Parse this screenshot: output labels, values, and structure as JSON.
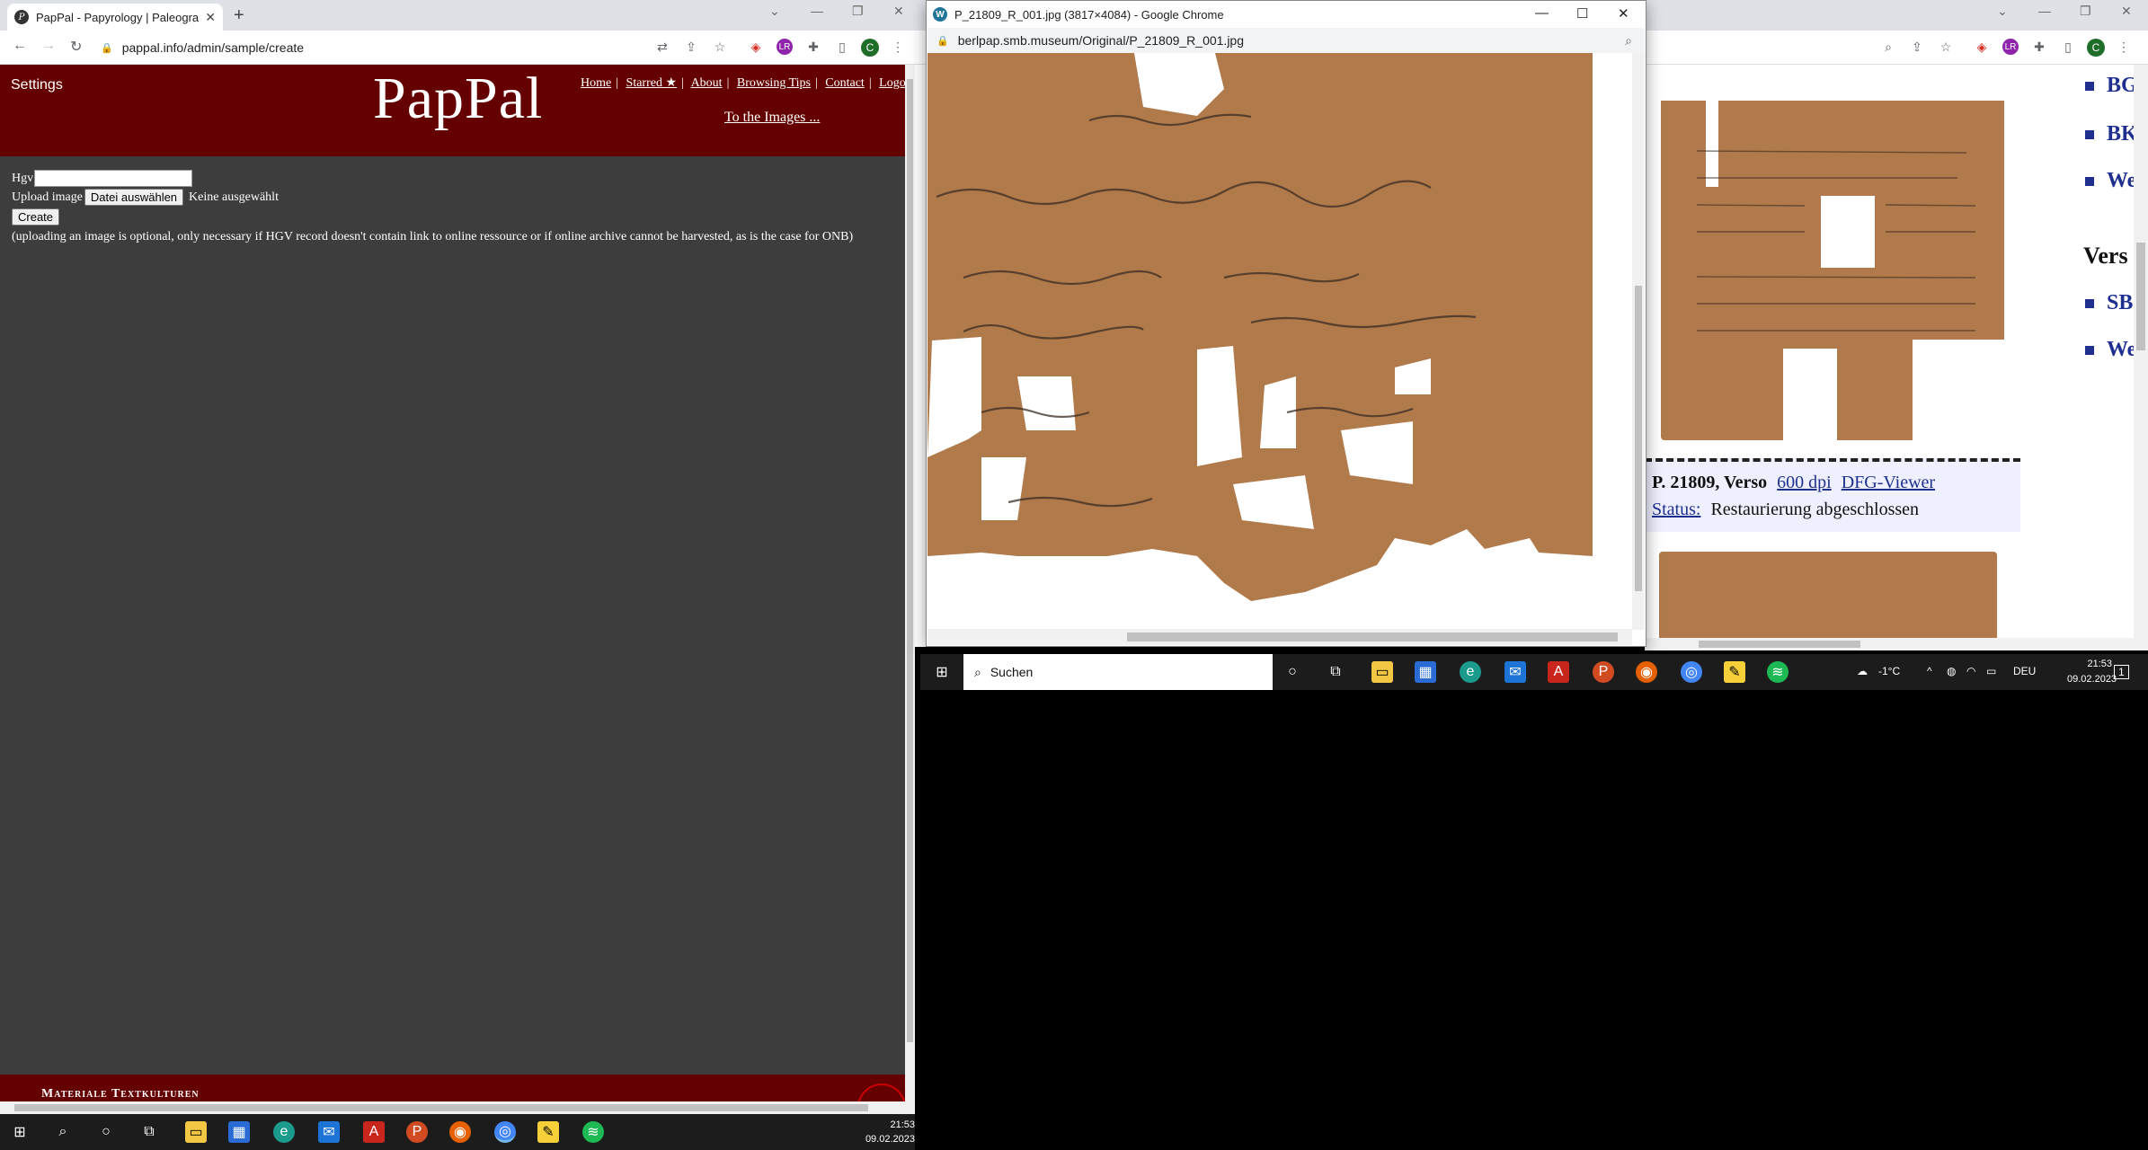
{
  "left_browser": {
    "tab_title": "PapPal - Papyrology | Paleograph",
    "url": "pappal.info/admin/sample/create",
    "avatar_letter": "C",
    "ext_badge": "LR"
  },
  "site": {
    "settings_label": "Settings",
    "logo": "PapPal",
    "nav": {
      "home": "Home",
      "starred": "Starred ★",
      "about": "About",
      "browsing_tips": "Browsing Tips",
      "contact": "Contact",
      "logout": "Logou"
    },
    "to_images": "To the Images ...",
    "form": {
      "hgv_label": "Hgv",
      "hgv_value": "",
      "upload_label": "Upload image",
      "file_button": "Datei auswählen",
      "file_status": "Keine ausgewählt",
      "create_button": "Create",
      "note": "(uploading an image is optional, only necessary if HGV record doesn't contain link to online ressource or if online archive cannot be harvested, as is the case for ONB)"
    },
    "footer_text": "Materiale Textkulturen"
  },
  "taskbar_left": {
    "time": "21:53",
    "date": "09.02.2023"
  },
  "popup": {
    "title": "P_21809_R_001.jpg (3817×4084) - Google Chrome",
    "url": "berlpap.smb.museum/Original/P_21809_R_001.jpg"
  },
  "right_page": {
    "bullets": [
      "BG",
      "BK",
      "We",
      "SB",
      "We"
    ],
    "heading": "Vers",
    "caption_prefix": "P. 21809, Verso",
    "link_600dpi": "600 dpi",
    "link_dfg": "DFG-Viewer",
    "status_label": "Status:",
    "status_value": "Restaurierung abgeschlossen"
  },
  "taskbar_right": {
    "search_placeholder": "Suchen",
    "temperature": "-1°C",
    "language": "DEU",
    "time": "21:53",
    "date": "09.02.2023",
    "notif_count": "1"
  },
  "icons": {
    "lock": "lock-icon",
    "star": "star-icon",
    "search": "search-icon",
    "windows": "windows-icon"
  },
  "colors": {
    "header_bg": "#640000",
    "page_bg": "#3d3d3d",
    "link_blue": "#1f2f8f",
    "papyrus": "#b07a4c"
  }
}
